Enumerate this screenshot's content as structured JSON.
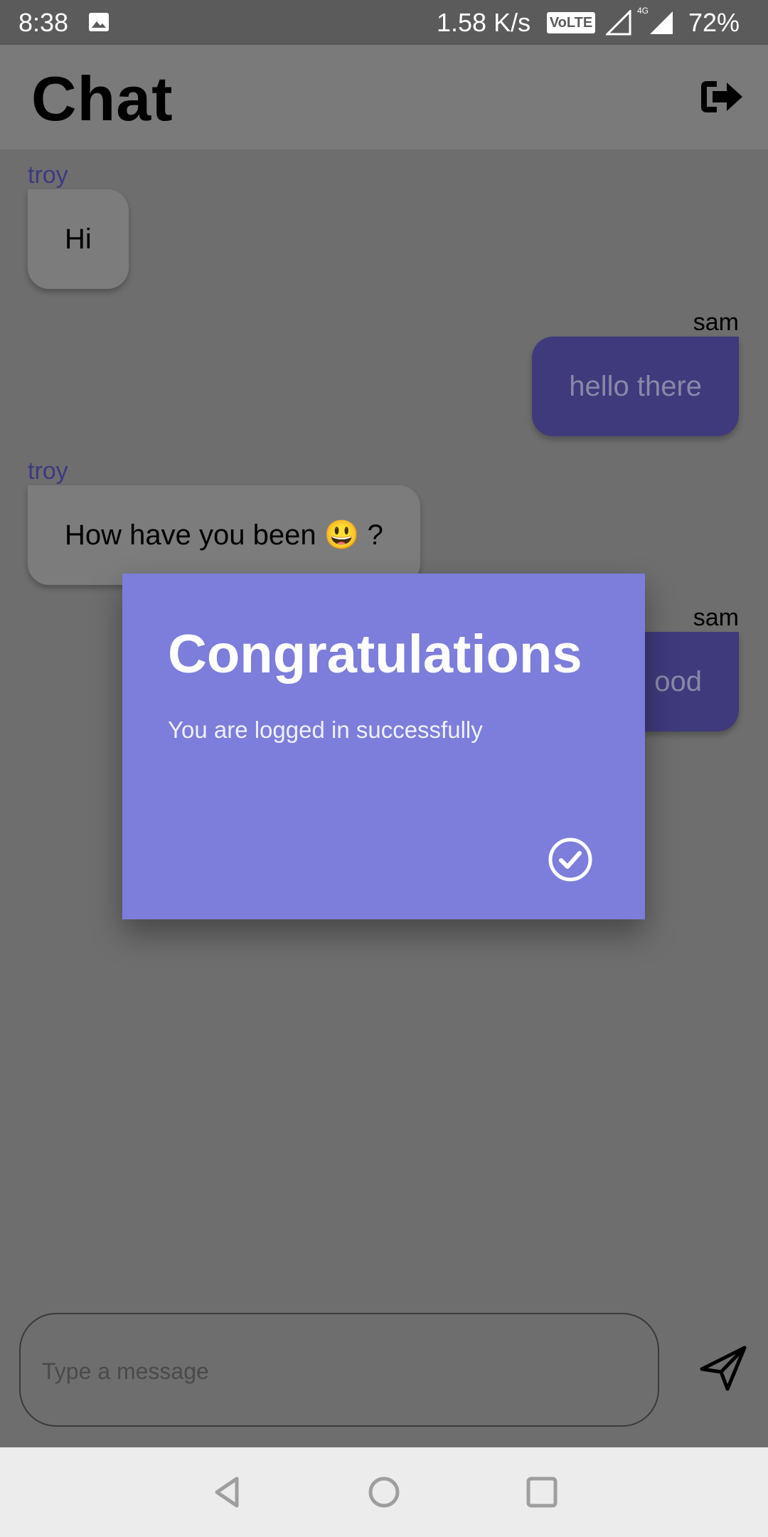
{
  "status_bar": {
    "time": "8:38",
    "network_speed": "1.58 K/s",
    "volte": "VoLTE",
    "network_type": "4G",
    "battery": "72%"
  },
  "app_bar": {
    "title": "Chat",
    "action_icon": "logout-icon"
  },
  "messages": [
    {
      "sender": "troy",
      "text": "Hi",
      "side": "left"
    },
    {
      "sender": "sam",
      "text": "hello there",
      "side": "right"
    },
    {
      "sender": "troy",
      "text": "How have you been 😃 ?",
      "side": "left"
    },
    {
      "sender": "sam",
      "text": "ood",
      "side": "right"
    }
  ],
  "dialog": {
    "title": "Congratulations",
    "message": "You are logged in successfully",
    "confirm_icon": "check-circle-icon"
  },
  "composer": {
    "placeholder": "Type a message",
    "send_icon": "send-icon"
  },
  "colors": {
    "dialog_bg": "#7d7ddb",
    "own_bubble": "#3e3a7c",
    "other_bubble": "#7c7c7c",
    "sender_left": "#3c3a80"
  }
}
